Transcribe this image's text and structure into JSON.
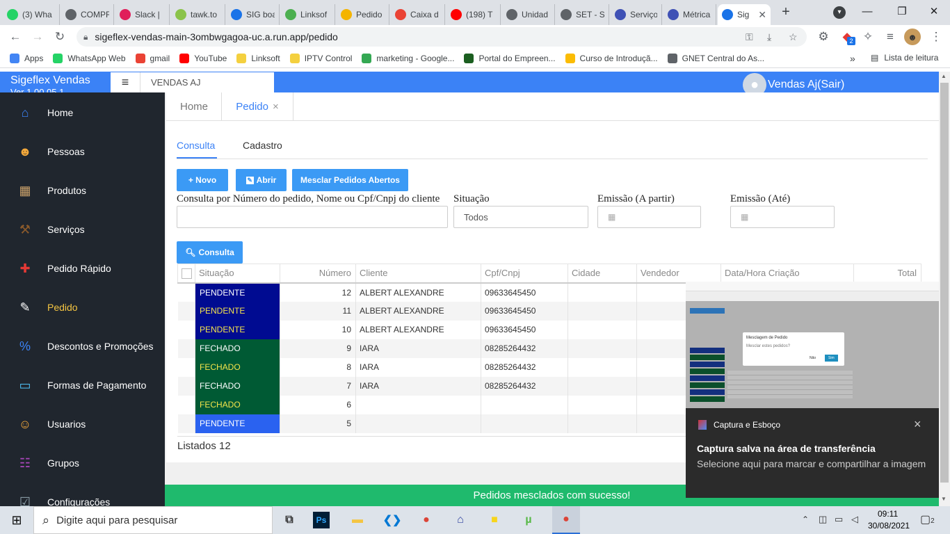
{
  "browser": {
    "tabs": [
      {
        "title": "(3) Wha",
        "color": "#25d366"
      },
      {
        "title": "COMPR",
        "color": "#5f6368"
      },
      {
        "title": "Slack | ",
        "color": "#e01e5a"
      },
      {
        "title": "tawk.to",
        "color": "#8bc34a"
      },
      {
        "title": "SIG boa",
        "color": "#1a73e8"
      },
      {
        "title": "Linksof",
        "color": "#4caf50"
      },
      {
        "title": "Pedido",
        "color": "#f4b400"
      },
      {
        "title": "Caixa d",
        "color": "#ea4335"
      },
      {
        "title": "(198) T",
        "color": "#ff0000"
      },
      {
        "title": "Unidad",
        "color": "#5f6368"
      },
      {
        "title": "SET - S",
        "color": "#5f6368"
      },
      {
        "title": "Serviço",
        "color": "#3f51b5"
      },
      {
        "title": "Métrica",
        "color": "#3f51b5"
      },
      {
        "title": "Sig",
        "color": "#1a73e8",
        "active": true
      }
    ],
    "new_tab": "+",
    "url": "sigeflex-vendas-main-3ombwgagoa-uc.a.run.app/pedido",
    "bookmarks": [
      {
        "label": "Apps",
        "color": "#4285f4"
      },
      {
        "label": "WhatsApp Web",
        "color": "#25d366"
      },
      {
        "label": "gmail",
        "color": "#ea4335"
      },
      {
        "label": "YouTube",
        "color": "#ff0000"
      },
      {
        "label": "Linksoft",
        "color": "#f4d03f"
      },
      {
        "label": "IPTV Control",
        "color": "#f4d03f"
      },
      {
        "label": "marketing - Google...",
        "color": "#34a853"
      },
      {
        "label": "Portal do Empreen...",
        "color": "#1b5e20"
      },
      {
        "label": "Curso de Introduçã...",
        "color": "#fbbc04"
      },
      {
        "label": "GNET Central do As...",
        "color": "#5f6368"
      }
    ],
    "bookmarks_overflow": "»",
    "reading_list": "Lista de leitura",
    "extension_badge": "2"
  },
  "app": {
    "title": "Sigeflex Vendas",
    "version": "Ver 1.00.05.1",
    "company_field": "VENDAS AJ",
    "user": "Vendas Aj(Sair)",
    "sidebar": [
      {
        "label": "Home",
        "icon": "home-icon",
        "color": "#3b82f6",
        "glyph": "⌂"
      },
      {
        "label": "Pessoas",
        "icon": "people-icon",
        "color": "#f4a93b",
        "glyph": "☻"
      },
      {
        "label": "Produtos",
        "icon": "boxes-icon",
        "color": "#c8a06a",
        "glyph": "▦"
      },
      {
        "label": "Serviços",
        "icon": "hammer-icon",
        "color": "#8b5a2b",
        "glyph": "⚒"
      },
      {
        "label": "Pedido Rápido",
        "icon": "basket-icon",
        "color": "#e53935",
        "glyph": "✚"
      },
      {
        "label": "Pedido",
        "icon": "order-icon",
        "color": "#ffffff",
        "glyph": "✎",
        "active": true
      },
      {
        "label": "Descontos e Promoções",
        "icon": "discount-icon",
        "color": "#3b82f6",
        "glyph": "%"
      },
      {
        "label": "Formas de Pagamento",
        "icon": "payment-icon",
        "color": "#4fc3f7",
        "glyph": "▭"
      },
      {
        "label": "Usuarios",
        "icon": "users-icon",
        "color": "#f4a93b",
        "glyph": "☺"
      },
      {
        "label": "Grupos",
        "icon": "groups-icon",
        "color": "#ab47bc",
        "glyph": "☷"
      },
      {
        "label": "Configurações",
        "icon": "settings-icon",
        "color": "#90a4ae",
        "glyph": "☑"
      }
    ],
    "page_tabs": [
      {
        "label": "Home"
      },
      {
        "label": "Pedido",
        "close": "×"
      }
    ],
    "sub_tabs": [
      "Consulta",
      "Cadastro"
    ],
    "buttons": {
      "novo": "+ Novo",
      "abrir": "Abrir",
      "mesclar": "Mesclar Pedidos Abertos",
      "consulta": "Consulta"
    },
    "filters": {
      "search_label": "Consulta por Número do pedido, Nome ou Cpf/Cnpj do cliente",
      "search_value": "",
      "situacao_label": "Situação",
      "situacao_value": "Todos",
      "emissao_de_label": "Emissão (A partir)",
      "emissao_ate_label": "Emissão (Até)"
    },
    "table": {
      "columns": [
        "Situação",
        "Número",
        "Cliente",
        "Cpf/Cnpj",
        "Cidade",
        "Vendedor",
        "Data/Hora Criação",
        "Total"
      ],
      "rows": [
        {
          "situacao": "PENDENTE",
          "color": "#000b91",
          "text_color": "#ffffff",
          "numero": "12",
          "cliente": "ALBERT ALEXANDRE",
          "cpf": "09633645450"
        },
        {
          "situacao": "PENDENTE",
          "color": "#000b91",
          "text_color": "#f5e44b",
          "numero": "11",
          "cliente": "ALBERT ALEXANDRE",
          "cpf": "09633645450"
        },
        {
          "situacao": "PENDENTE",
          "color": "#000b91",
          "text_color": "#f5e44b",
          "numero": "10",
          "cliente": "ALBERT ALEXANDRE",
          "cpf": "09633645450"
        },
        {
          "situacao": "FECHADO",
          "color": "#005a34",
          "text_color": "#ffffff",
          "numero": "9",
          "cliente": "IARA",
          "cpf": "08285264432"
        },
        {
          "situacao": "FECHADO",
          "color": "#005a34",
          "text_color": "#f5e44b",
          "numero": "8",
          "cliente": "IARA",
          "cpf": "08285264432"
        },
        {
          "situacao": "FECHADO",
          "color": "#005a34",
          "text_color": "#ffffff",
          "numero": "7",
          "cliente": "IARA",
          "cpf": "08285264432"
        },
        {
          "situacao": "FECHADO",
          "color": "#005a34",
          "text_color": "#f5e44b",
          "numero": "6",
          "cliente": "",
          "cpf": ""
        },
        {
          "situacao": "PENDENTE",
          "color": "#2a62f0",
          "text_color": "#ffffff",
          "numero": "5",
          "cliente": "",
          "cpf": ""
        }
      ]
    },
    "listados": "Listados 12",
    "toast": "Pedidos mesclados com sucesso!"
  },
  "notification": {
    "app": "Captura e Esboço",
    "title": "Captura salva na área de transferência",
    "body": "Selecione aqui para marcar e compartilhar a imagem",
    "close": "×",
    "thumb_dialog_title": "Mesclagem de Pedido",
    "thumb_dialog_text": "Mesclar estes pedidos?",
    "thumb_no": "Não",
    "thumb_yes": "Sim"
  },
  "taskbar": {
    "search_placeholder": "Digite aqui para pesquisar",
    "time": "09:11",
    "date": "30/08/2021",
    "notif_count": "2",
    "apps": [
      {
        "name": "task-view-icon",
        "color": "#333333",
        "glyph": "⧉"
      },
      {
        "name": "photoshop-icon",
        "color": "#001e36",
        "glyph": "Ps"
      },
      {
        "name": "file-explorer-icon",
        "color": "#f4c542",
        "glyph": "▬"
      },
      {
        "name": "vscode-icon",
        "color": "#0078d4",
        "glyph": "❮❯"
      },
      {
        "name": "chrome-icon",
        "color": "#db4437",
        "glyph": "●"
      },
      {
        "name": "app-icon",
        "color": "#2c3e9f",
        "glyph": "⌂"
      },
      {
        "name": "sticky-notes-icon",
        "color": "#f7d51d",
        "glyph": "■"
      },
      {
        "name": "utorrent-icon",
        "color": "#58b947",
        "glyph": "µ"
      },
      {
        "name": "chrome-profile-icon",
        "color": "#db4437",
        "glyph": "●"
      }
    ]
  }
}
